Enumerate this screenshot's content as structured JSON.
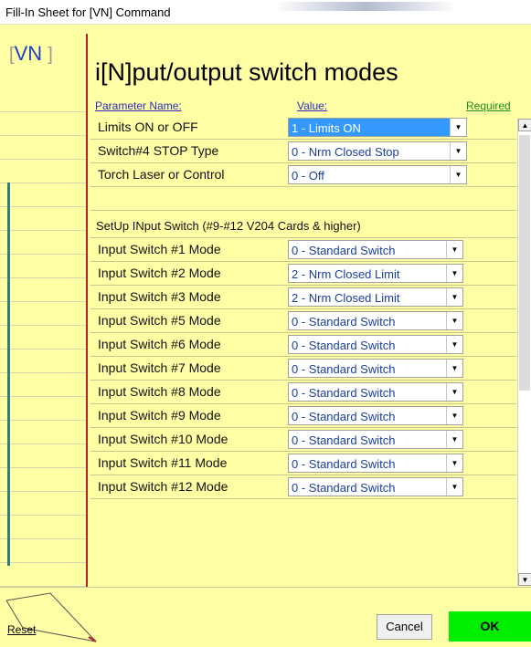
{
  "window": {
    "title": "Fill-In Sheet for [VN] Command"
  },
  "tag": {
    "open_bracket": "[",
    "code": "VN",
    "close_bracket": "]"
  },
  "heading": "i[N]put/output switch modes",
  "columns": {
    "name": "Parameter Name:",
    "value": "Value:",
    "required": "Required"
  },
  "rows": [
    {
      "label": "Limits ON or OFF",
      "value": "1 - Limits ON"
    },
    {
      "label": "Switch#4 STOP Type",
      "value": "0 - Nrm Closed Stop"
    },
    {
      "label": "Torch Laser or Control",
      "value": "0 - Off"
    }
  ],
  "section_title": "SetUp INput Switch (#9-#12 V204 Cards & higher)",
  "input_rows": [
    {
      "label": "Input Switch #1 Mode",
      "value": "0 - Standard Switch"
    },
    {
      "label": "Input Switch #2 Mode",
      "value": "2 - Nrm Closed Limit"
    },
    {
      "label": "Input Switch #3 Mode",
      "value": "2 - Nrm Closed Limit"
    },
    {
      "label": "Input Switch #5 Mode",
      "value": "0 - Standard Switch"
    },
    {
      "label": "Input Switch #6 Mode",
      "value": "0 - Standard Switch"
    },
    {
      "label": "Input Switch #7 Mode",
      "value": "0 - Standard Switch"
    },
    {
      "label": "Input Switch #8 Mode",
      "value": "0 - Standard Switch"
    },
    {
      "label": "Input Switch #9 Mode",
      "value": "0 - Standard Switch"
    },
    {
      "label": "Input Switch #10 Mode",
      "value": "0 - Standard Switch"
    },
    {
      "label": "Input Switch #11 Mode",
      "value": "0 - Standard Switch"
    },
    {
      "label": "Input Switch #12 Mode",
      "value": "0 - Standard Switch"
    }
  ],
  "buttons": {
    "reset": "Reset",
    "cancel": "Cancel",
    "ok": "OK"
  },
  "colors": {
    "background": "#ffffa6",
    "ok": "#00ee00",
    "divider": "#b22222",
    "selected": "#3399ff"
  },
  "icons": {
    "dropdown": "chevron-down-icon",
    "scroll_up": "scroll-up-icon",
    "scroll_down": "scroll-down-icon"
  }
}
